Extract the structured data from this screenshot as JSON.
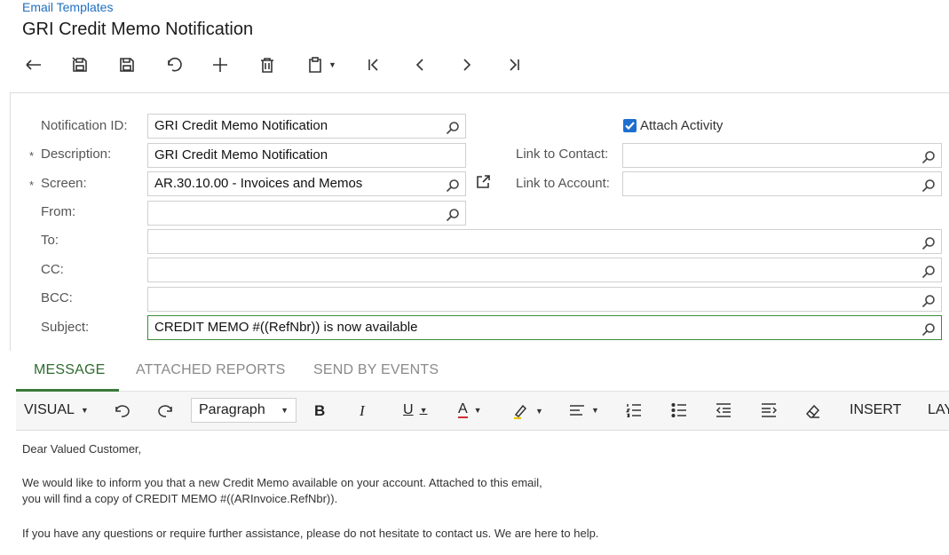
{
  "breadcrumb": "Email Templates",
  "title": "GRI Credit Memo Notification",
  "toolbar": [
    {
      "name": "back-icon"
    },
    {
      "name": "save-close-icon"
    },
    {
      "name": "save-icon"
    },
    {
      "name": "undo-icon"
    },
    {
      "name": "add-icon"
    },
    {
      "name": "delete-icon"
    },
    {
      "name": "clipboard-icon"
    },
    {
      "name": "first-record-icon"
    },
    {
      "name": "previous-record-icon"
    },
    {
      "name": "next-record-icon"
    },
    {
      "name": "last-record-icon"
    }
  ],
  "form": {
    "notification_id": {
      "label": "Notification ID:",
      "value": "GRI Credit Memo Notification"
    },
    "description": {
      "label": "Description:",
      "value": "GRI Credit Memo Notification"
    },
    "screen": {
      "label": "Screen:",
      "value": "AR.30.10.00 - Invoices and Memos"
    },
    "from": {
      "label": "From:",
      "value": ""
    },
    "to": {
      "label": "To:",
      "value": ""
    },
    "cc": {
      "label": "CC:",
      "value": ""
    },
    "bcc": {
      "label": "BCC:",
      "value": ""
    },
    "subject": {
      "label": "Subject:",
      "value": "CREDIT MEMO #((RefNbr)) is now available"
    },
    "attach_activity": {
      "label": "Attach Activity",
      "checked": true
    },
    "link_to_contact": {
      "label": "Link to Contact:",
      "value": ""
    },
    "link_to_account": {
      "label": "Link to Account:",
      "value": ""
    },
    "required_marker": "*"
  },
  "tabs": [
    {
      "label": "MESSAGE",
      "active": true
    },
    {
      "label": "ATTACHED REPORTS",
      "active": false
    },
    {
      "label": "SEND BY EVENTS",
      "active": false
    }
  ],
  "editor": {
    "mode": "VISUAL",
    "paragraph": "Paragraph",
    "bold": "B",
    "italic": "I",
    "underline": "U",
    "font_color": "A",
    "insert": "INSERT",
    "layout": "LAY",
    "font_color_accent": "#d03030",
    "highlight_accent": "#e8c400"
  },
  "message": {
    "line1": "Dear Valued Customer,",
    "line2": "We would like to inform you that a new Credit Memo available on your account. Attached to this email,",
    "line3": "you will find a copy of CREDIT MEMO #((ARInvoice.RefNbr)).",
    "line4": "If you have any questions or require further assistance, please do not hesitate to contact us. We are here to help."
  }
}
